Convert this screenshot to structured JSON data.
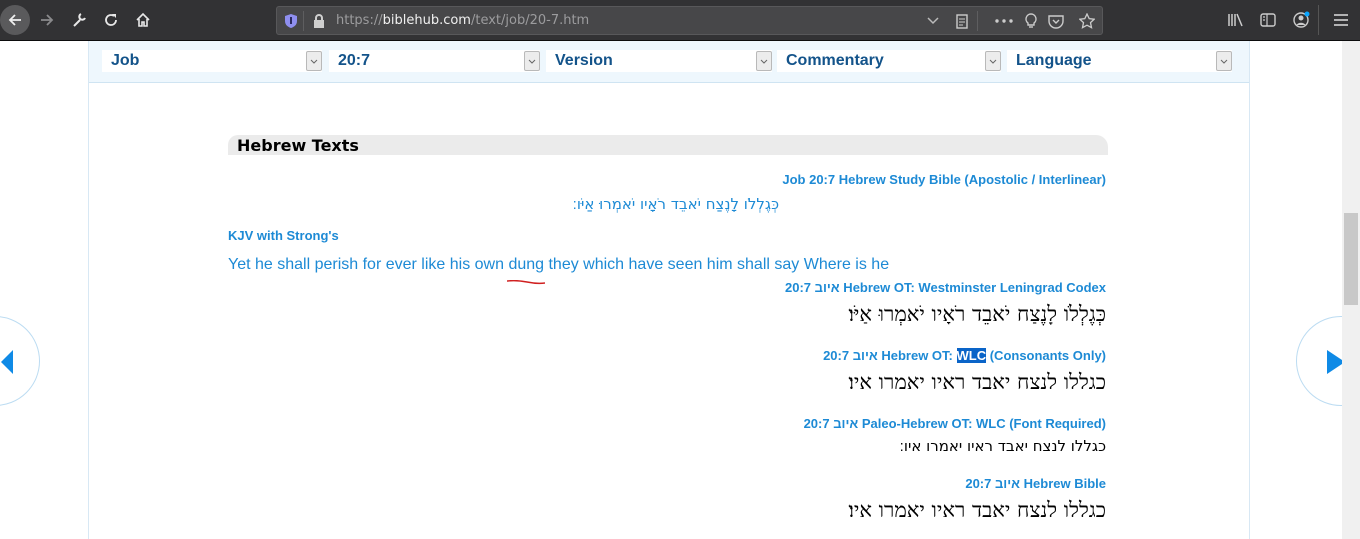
{
  "browser": {
    "url_scheme": "https://",
    "url_host": "biblehub.com",
    "url_path": "/text/job/20-7.htm",
    "icons": [
      "back-icon",
      "forward-icon",
      "wrench-icon",
      "reload-icon",
      "home-icon",
      "shield-icon",
      "lock-icon",
      "chevron-down-icon",
      "reader-view-icon",
      "more-icon",
      "lightbulb-icon",
      "pocket-icon",
      "star-icon",
      "library-icon",
      "sidebar-icon",
      "account-icon",
      "menu-icon"
    ]
  },
  "nav": {
    "book": "Job",
    "chapter_verse": "20:7",
    "version": "Version",
    "commentary": "Commentary",
    "language": "Language"
  },
  "section": {
    "title": "Hebrew Texts"
  },
  "entries": {
    "study_bible_link": "Job 20:7 Hebrew Study Bible (Apostolic / Interlinear)",
    "study_bible_text": "כְּגֶלְלֹו לָנֶצַח יֹאבֵד רֹאָיו יֹאמְרוּ אַיֹּו׃",
    "kjv_link": "KJV with Strong's",
    "kjv_text": "Yet he shall perish for ever like his own dung they which have seen him shall say Where is he",
    "wlc_link": "20:7 איוב Hebrew OT: Westminster Leningrad Codex",
    "wlc_text": "כְּגֶלְלֹו לָנֶצַח יֹאבֵד רֹאָיו יֹאמְרוּ אַיֹּו׃",
    "cons_link_pre": "20:7 איוב Hebrew OT: ",
    "cons_link_hl": "WLC",
    "cons_link_post": " (Consonants Only)",
    "cons_text": "כגללו לנצח יאבד ראיו יאמרו איו׃",
    "paleo_link": "20:7 איוב Paleo-Hebrew OT: WLC (Font Required)",
    "paleo_text": "כגללו לנצח יאבד ראיו יאמרו איו׃",
    "hb_link": "20:7 איוב Hebrew Bible",
    "hb_text": "כגללו לנצח יאבד ראיו יאמרו איו׃"
  },
  "colors": {
    "link": "#1d8ad5",
    "nav_text": "#13538a",
    "nav_arrow": "#0f8ae6"
  }
}
